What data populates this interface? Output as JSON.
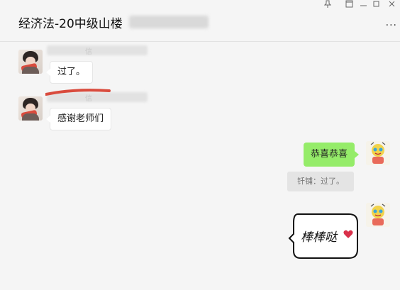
{
  "window": {
    "title_visible": "经济法-20中级山楼",
    "controls": [
      "pin-icon",
      "maximize-icon",
      "minimize-icon",
      "restore-icon",
      "close-icon"
    ],
    "more_label": "···"
  },
  "messages": [
    {
      "side": "left",
      "sender_char": "信",
      "text": "过了。"
    },
    {
      "side": "left",
      "sender_char": "信",
      "text": "感谢老师们"
    },
    {
      "side": "right",
      "text": "恭喜恭喜"
    },
    {
      "side": "right",
      "quote": "钎铺：过了。"
    },
    {
      "side": "right",
      "sticker_text": "棒棒哒"
    }
  ],
  "colors": {
    "self_bubble": "#95ec69",
    "other_bubble": "#ffffff",
    "background": "#f5f5f5",
    "redaction": "#d94b3d"
  }
}
